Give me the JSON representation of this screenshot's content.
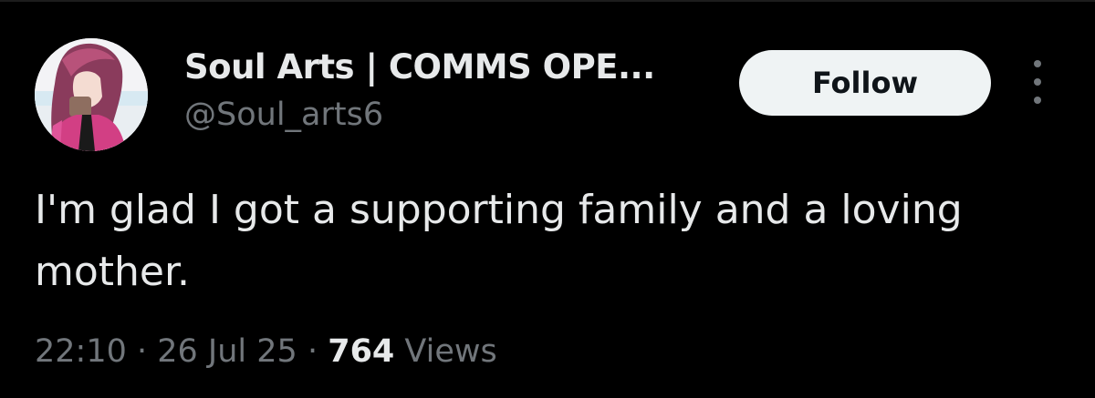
{
  "tweet": {
    "author": {
      "display_name": "Soul Arts | COMMS OPE...",
      "handle": "@Soul_arts6",
      "avatar_icon": "anime-girl-avatar"
    },
    "follow_label": "Follow",
    "more_icon": "more-vertical-icon",
    "text": "I'm glad I got a supporting family and a loving mother.",
    "time": "22:10",
    "separator": " · ",
    "date": "26 Jul 25",
    "view_count": "764",
    "views_label": "Views"
  },
  "colors": {
    "background": "#000000",
    "primary_text": "#e7e9ea",
    "secondary_text": "#71767b",
    "follow_button_bg": "#eff3f4",
    "follow_button_text": "#0f1419"
  }
}
